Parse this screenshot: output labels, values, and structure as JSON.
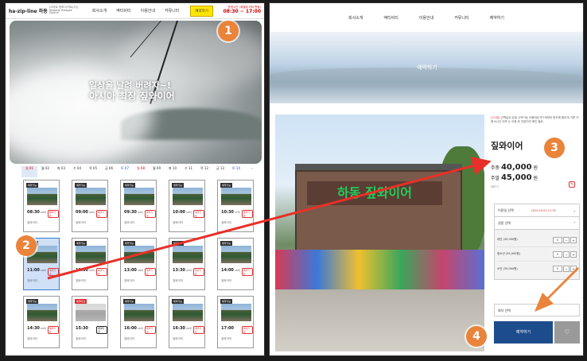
{
  "left": {
    "logo": "ha-zip-line 하동",
    "logo_sub": "(스타트 정보/사이트(사)) Hadong-Hwagae Zipline",
    "nav": [
      "회사소개",
      "액티비티",
      "이용안내",
      "커뮤니티"
    ],
    "reserve_button": "예약하기",
    "hours_label": "운영시간 (계절에 따라 변동)",
    "hours": "08:30 ~ 17:00",
    "hero_line1": "일상을 날려 버려자~!",
    "hero_line2": "아시아 최장 짚와이어",
    "dates": [
      "일 01",
      "월 02",
      "화 03",
      "수 04",
      "목 05",
      "금 06",
      "토 07",
      "일 08",
      "월 09",
      "화 10",
      "수 11",
      "목 12",
      "금 13",
      "토 14",
      "›"
    ],
    "slots": [
      {
        "badge": "예약가능",
        "time": "08:30",
        "count": "20석",
        "btn": "예약가능",
        "name": "짚와이어"
      },
      {
        "badge": "예약가능",
        "time": "09:00",
        "count": "20석",
        "btn": "예약가능",
        "name": "짚와이어"
      },
      {
        "badge": "예약가능",
        "time": "09:30",
        "count": "20석",
        "btn": "예약가능",
        "name": "짚와이어"
      },
      {
        "badge": "예약가능",
        "time": "10:00",
        "count": "12석",
        "btn": "예약가능",
        "name": "짚와이어"
      },
      {
        "badge": "예약가능",
        "time": "10:30",
        "count": "17석",
        "btn": "예약가능",
        "name": "짚와이어"
      },
      {
        "badge": "예약가능",
        "time": "11:00",
        "count": "16석",
        "btn": "예약가능",
        "name": "짚와이어"
      },
      {
        "badge": "예약가능",
        "time": "11:30",
        "count": "10석",
        "btn": "예약가능",
        "name": "짚와이어"
      },
      {
        "badge": "예약가능",
        "time": "13:00",
        "count": "18석",
        "btn": "예약가능",
        "name": "짚와이어"
      },
      {
        "badge": "예약가능",
        "time": "13:30",
        "count": "20석",
        "btn": "예약가능",
        "name": "짚와이어"
      },
      {
        "badge": "예약가능",
        "time": "14:00",
        "count": "16석",
        "btn": "예약가능",
        "name": "짚와이어"
      },
      {
        "badge": "예약가능",
        "time": "14:30",
        "count": "20석",
        "btn": "예약가능",
        "name": "짚와이어"
      },
      {
        "badge": "예약마감",
        "time": "15:30",
        "count": "",
        "btn": "예약마감",
        "name": "짚와이어"
      },
      {
        "badge": "예약가능",
        "time": "16:00",
        "count": "15석",
        "btn": "예약가능",
        "name": "짚와이어"
      },
      {
        "badge": "예약가능",
        "time": "16:30",
        "count": "20석",
        "btn": "예약가능",
        "name": "짚와이어"
      },
      {
        "badge": "예약가능",
        "time": "17:00",
        "count": "",
        "btn": "예약가능",
        "name": "짚와이어"
      }
    ]
  },
  "right": {
    "nav": [
      "회사소개",
      "액티비티",
      "이용안내",
      "커뮤니티",
      "예약하기"
    ],
    "banner_title": "예약하기",
    "desc_tag": "[주1회]",
    "desc": "선백날씨 당일 시작기능 이용대상 만7세부터 한도체 몸무게 기준 이용 6시간 이하 는 이용 후 관련이의 확인 필요",
    "title": "짚와이어",
    "weekday_label": "주중",
    "weekday_price": "40,000",
    "weekend_label": "주말",
    "weekend_price": "45,000",
    "won": "원",
    "note": "내보기",
    "date_label": "이용일 선택",
    "date_value": "2024.09.01 11:30",
    "type_label": "권종 선택",
    "qty": [
      {
        "label": "대인 (45,000원)",
        "value": "0"
      },
      {
        "label": "청소년 (35,000원)",
        "value": "0"
      },
      {
        "label": "소인 (30,000원)",
        "value": "0"
      }
    ],
    "time_label": "회차 선택",
    "book_button": "예약하기",
    "like_icon": "♡"
  },
  "markers": [
    "1",
    "2",
    "3",
    "4"
  ]
}
